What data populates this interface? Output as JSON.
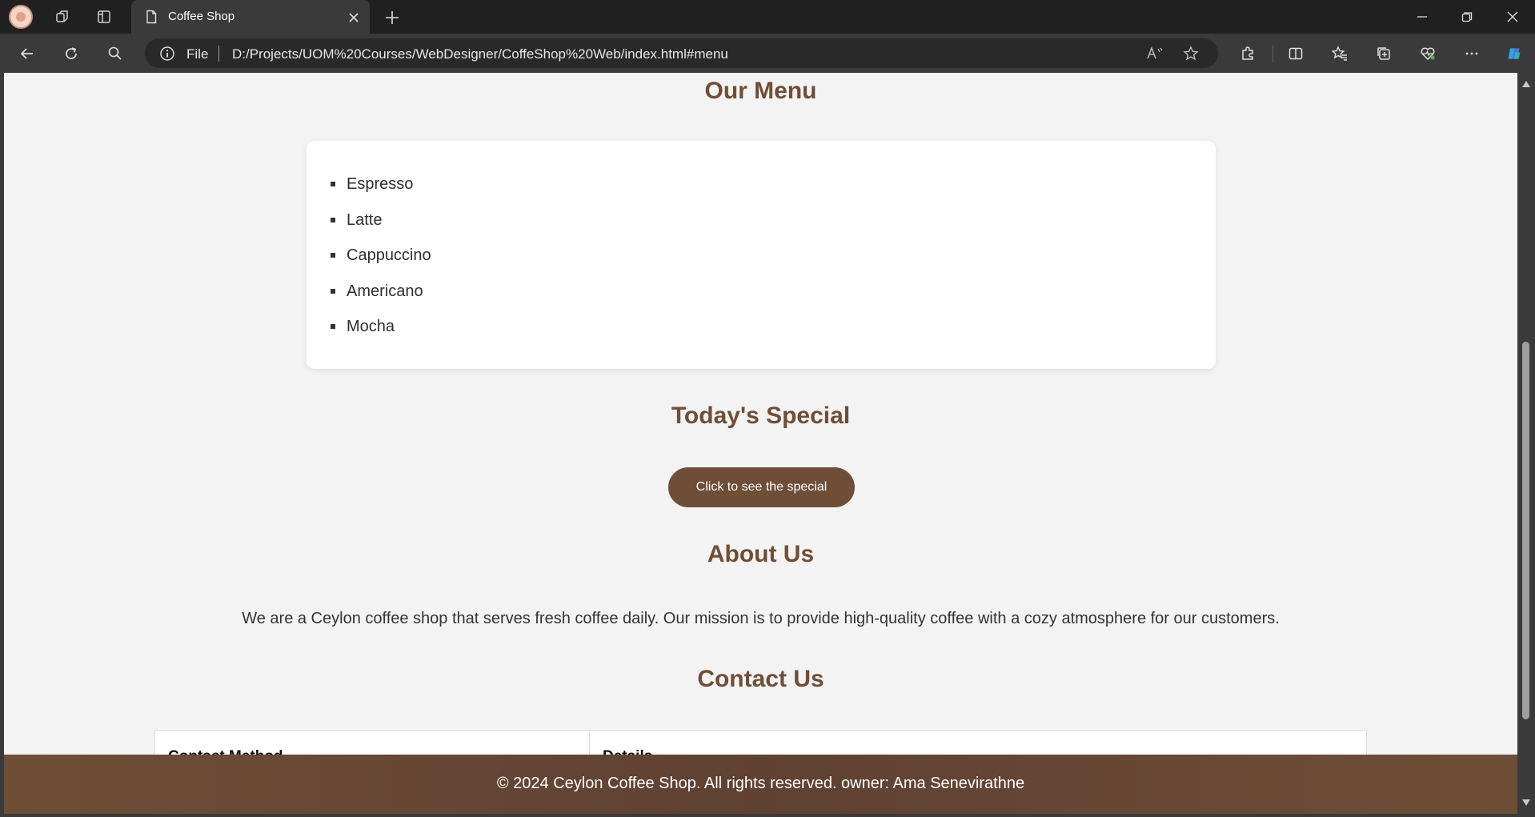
{
  "browser": {
    "tab_title": "Coffee Shop",
    "omnibox_prefix": "File",
    "url": "D:/Projects/UOM%20Courses/WebDesigner/CoffeShop%20Web/index.html#menu"
  },
  "colors": {
    "accent": "#6f4e37",
    "page_bg": "#f3f3f3",
    "chrome_dark": "#202020",
    "chrome_mid": "#3a3a3a"
  },
  "menu": {
    "heading": "Our Menu",
    "items": [
      "Espresso",
      "Latte",
      "Cappuccino",
      "Americano",
      "Mocha"
    ]
  },
  "special": {
    "heading": "Today's Special",
    "button_label": "Click to see the special"
  },
  "about": {
    "heading": "About Us",
    "text": "We are a Ceylon coffee shop that serves fresh coffee daily. Our mission is to provide high-quality coffee with a cozy atmosphere for our customers."
  },
  "contact": {
    "heading": "Contact Us",
    "columns": [
      "Contact Method",
      "Details"
    ]
  },
  "footer": {
    "text": "© 2024 Ceylon Coffee Shop. All rights reserved. owner: Ama Senevirathne"
  }
}
